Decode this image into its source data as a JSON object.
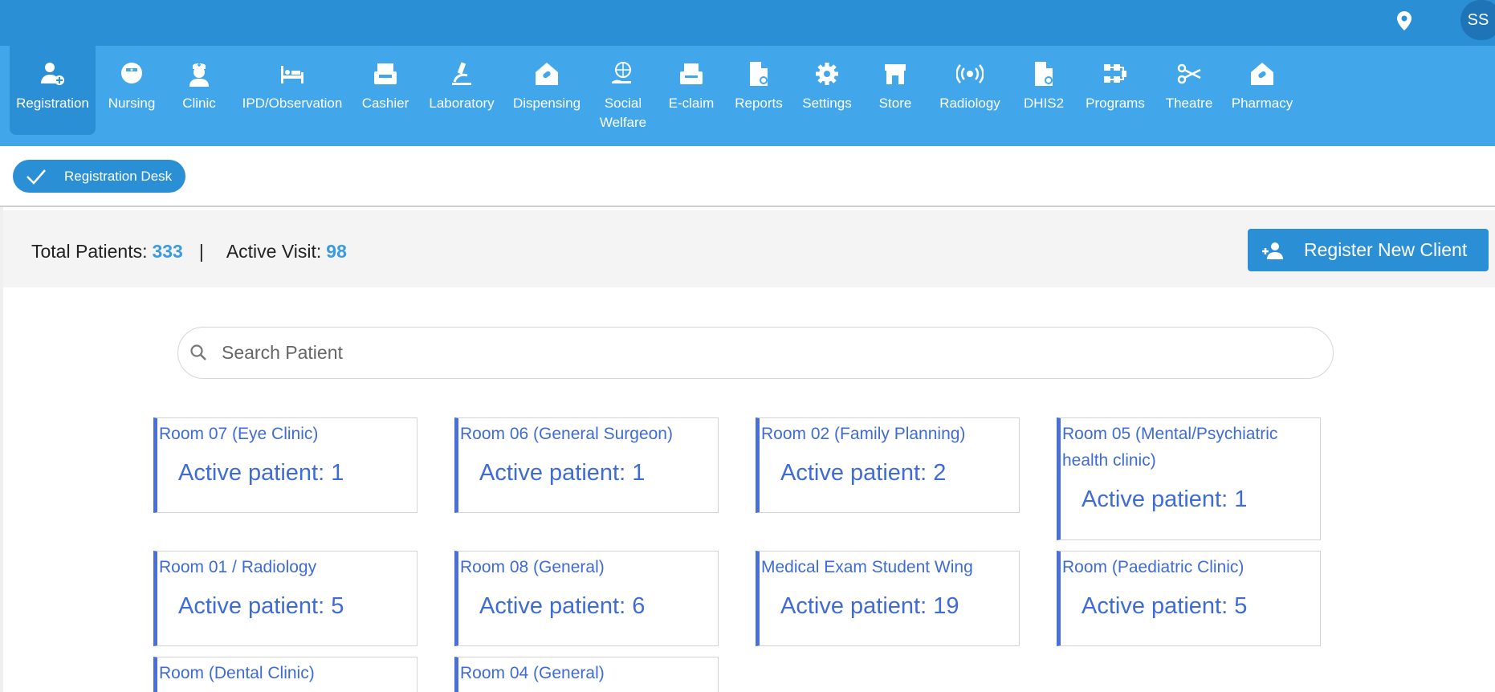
{
  "header": {
    "user_initials": "SS"
  },
  "nav": [
    {
      "label": "Registration",
      "icon": "user-plus-icon"
    },
    {
      "label": "Nursing",
      "icon": "nurse-icon"
    },
    {
      "label": "Clinic",
      "icon": "doctor-icon"
    },
    {
      "label": "IPD/Observation",
      "icon": "bed-icon"
    },
    {
      "label": "Cashier",
      "icon": "cash-register-icon"
    },
    {
      "label": "Laboratory",
      "icon": "microscope-icon"
    },
    {
      "label": "Dispensing",
      "icon": "pill-house-icon"
    },
    {
      "label": "Social Welfare",
      "icon": "globe-hand-icon"
    },
    {
      "label": "E-claim",
      "icon": "printer-icon"
    },
    {
      "label": "Reports",
      "icon": "report-icon"
    },
    {
      "label": "Settings",
      "icon": "gear-icon"
    },
    {
      "label": "Store",
      "icon": "store-icon"
    },
    {
      "label": "Radiology",
      "icon": "radiation-icon"
    },
    {
      "label": "DHIS2",
      "icon": "file-chart-icon"
    },
    {
      "label": "Programs",
      "icon": "flow-icon"
    },
    {
      "label": "Theatre",
      "icon": "scissors-icon"
    },
    {
      "label": "Pharmacy",
      "icon": "pill-house-icon"
    }
  ],
  "desk": {
    "label": "Registration Desk"
  },
  "stats": {
    "total_label": "Total Patients:",
    "total_value": "333",
    "separator": "|",
    "active_label": "Active Visit:",
    "active_value": "98"
  },
  "register_button": {
    "label": "Register New Client"
  },
  "search": {
    "placeholder": "Search Patient",
    "value": ""
  },
  "rooms": [
    {
      "name": "Room 07 (Eye Clinic)",
      "active": "Active patient: 1"
    },
    {
      "name": "Room 06 (General Surgeon)",
      "active": "Active patient: 1"
    },
    {
      "name": "Room 02 (Family Planning)",
      "active": "Active patient: 2"
    },
    {
      "name": "Room 05 (Mental/Psychiatric health clinic)",
      "active": "Active patient: 1"
    },
    {
      "name": "Room 01 / Radiology",
      "active": "Active patient: 5"
    },
    {
      "name": "Room 08 (General)",
      "active": "Active patient: 6"
    },
    {
      "name": "Medical Exam Student Wing",
      "active": "Active patient: 19"
    },
    {
      "name": "Room (Paediatric Clinic)",
      "active": "Active patient: 5"
    },
    {
      "name": "Room (Dental Clinic)",
      "active": ""
    },
    {
      "name": "Room 04 (General)",
      "active": ""
    }
  ],
  "colors": {
    "topbar": "#2b8fd6",
    "navbar": "#42a7ea",
    "accent": "#3f6bd6"
  }
}
